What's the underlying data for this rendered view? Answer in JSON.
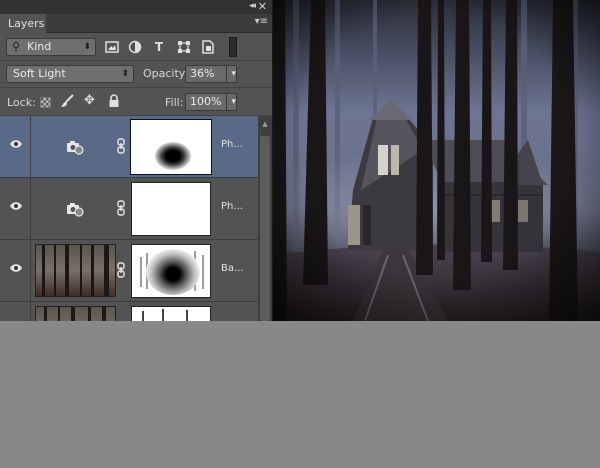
{
  "panel": {
    "tab_label": "Layers",
    "collapse_glyph": "◂◂",
    "close_glyph": "✕",
    "menu_glyph": "▾≡"
  },
  "filter": {
    "kind_label": "Kind",
    "icons": [
      "pixel-filter-icon",
      "adjustment-filter-icon",
      "type-filter-icon",
      "shape-filter-icon",
      "smart-object-filter-icon"
    ]
  },
  "blend": {
    "mode": "Soft Light",
    "opacity_label": "Opacity:",
    "opacity_value": "36%"
  },
  "lock": {
    "label": "Lock:",
    "fill_label": "Fill:",
    "fill_value": "100%"
  },
  "layers": [
    {
      "name": "Ph...",
      "type": "adjustment",
      "selected": true,
      "visible": true
    },
    {
      "name": "Ph...",
      "type": "adjustment",
      "selected": false,
      "visible": true
    },
    {
      "name": "Ba...",
      "type": "pixel",
      "selected": false,
      "visible": true
    },
    {
      "name": "",
      "type": "pixel",
      "selected": false,
      "visible": true
    }
  ],
  "colors": {
    "panel_bg": "#535353",
    "selected_layer": "#5a6986",
    "workspace_gray": "#888888"
  }
}
